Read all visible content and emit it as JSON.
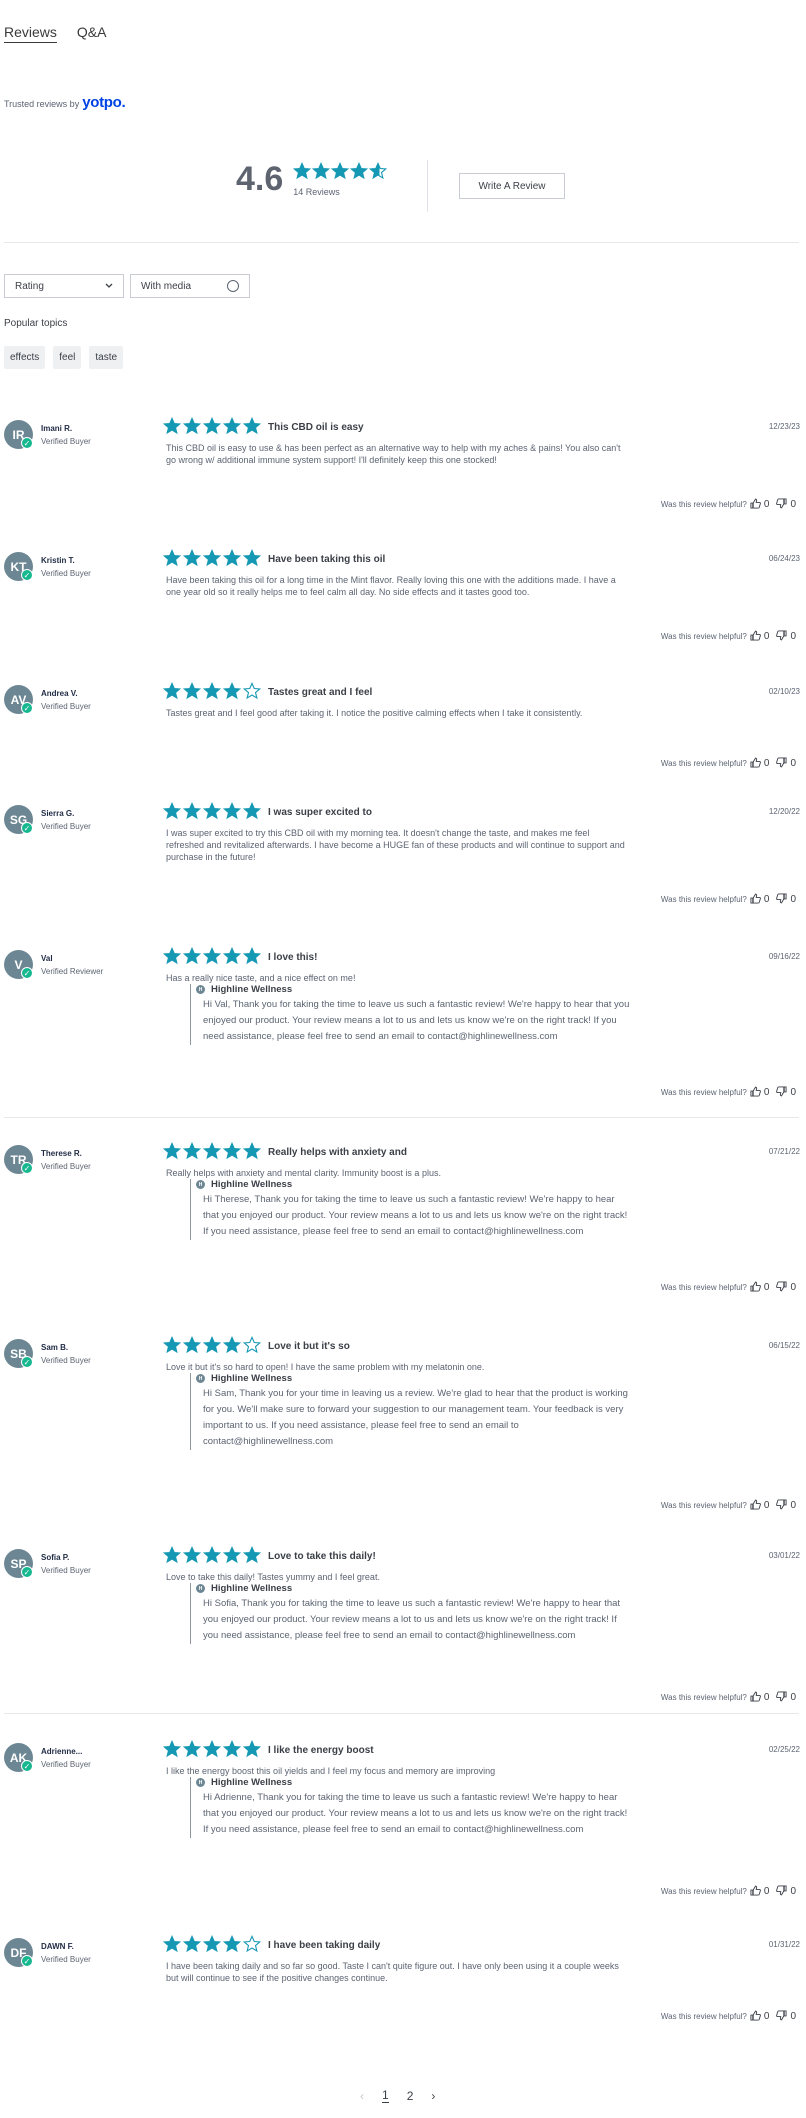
{
  "tabs": [
    {
      "label": "Reviews",
      "active": true
    },
    {
      "label": "Q&A",
      "active": false
    }
  ],
  "trusted": {
    "text": "Trusted reviews by",
    "brand": "yotpo."
  },
  "summary": {
    "average": "4.6",
    "count_label": "14 Reviews",
    "rating": 4.6,
    "write_label": "Write A Review"
  },
  "filters": {
    "rating_label": "Rating",
    "media_label": "With media"
  },
  "topics": {
    "label": "Popular topics",
    "items": [
      "effects",
      "feel",
      "taste"
    ]
  },
  "helpful_label": "Was this review helpful?",
  "colors": {
    "star": "#1598b3",
    "avatar": "#6c8793",
    "verified": "#17b890",
    "brand": "#0042e4"
  },
  "reviews": [
    {
      "initials": "IR",
      "name": "Imani R.",
      "badge": "Verified Buyer",
      "rating": 5,
      "title": "This CBD oil is easy",
      "date": "12/23/23",
      "body": "This CBD oil is easy to use & has been perfect as an alternative way to help with my aches & pains! You also can't go wrong w/ additional immune system support! I'll definitely keep this one stocked!",
      "up": "0",
      "down": "0"
    },
    {
      "initials": "KT",
      "name": "Kristin T.",
      "badge": "Verified Buyer",
      "rating": 5,
      "title": "Have been taking this oil",
      "date": "06/24/23",
      "body": "Have been taking this oil for a long time in the Mint flavor. Really loving this one with the additions made. I have a one year old so it really helps me to feel calm all day. No side effects and it tastes good too.",
      "up": "0",
      "down": "0"
    },
    {
      "initials": "AV",
      "name": "Andrea V.",
      "badge": "Verified Buyer",
      "rating": 4,
      "title": "Tastes great and I feel",
      "date": "02/10/23",
      "body": "Tastes great and I feel good after taking it. I notice the positive calming effects when I take it consistently.",
      "up": "0",
      "down": "0"
    },
    {
      "initials": "SG",
      "name": "Sierra G.",
      "badge": "Verified Buyer",
      "rating": 5,
      "title": "I was super excited to",
      "date": "12/20/22",
      "body": "I was super excited to try this CBD oil with my morning tea. It doesn't change the taste, and makes me feel refreshed and revitalized afterwards. I have become a HUGE fan of these products and will continue to support and purchase in the future!",
      "up": "0",
      "down": "0"
    },
    {
      "initials": "V",
      "name": "Val",
      "badge": "Verified Reviewer",
      "rating": 5,
      "title": "I love this!",
      "date": "09/16/22",
      "body": "Has a really nice taste, and a nice effect on me!",
      "reply_from": "Highline Wellness",
      "reply": "Hi Val, Thank you for taking the time to leave us such a fantastic review! We're happy to hear that you enjoyed our product. Your review means a lot to us and lets us know we're on the right track! If you need assistance, please feel free to send an email to contact@highlinewellness.com",
      "up": "0",
      "down": "0"
    },
    {
      "initials": "TR",
      "name": "Therese R.",
      "badge": "Verified Buyer",
      "rating": 5,
      "title": "Really helps with anxiety and",
      "date": "07/21/22",
      "body": "Really helps with anxiety and mental clarity. Immunity boost is a plus.",
      "reply_from": "Highline Wellness",
      "reply": "Hi Therese, Thank you for taking the time to leave us such a fantastic review! We're happy to hear that you enjoyed our product. Your review means a lot to us and lets us know we're on the right track! If you need assistance, please feel free to send an email to contact@highlinewellness.com",
      "up": "0",
      "down": "0"
    },
    {
      "initials": "SB",
      "name": "Sam B.",
      "badge": "Verified Buyer",
      "rating": 4,
      "title": "Love it but it's so",
      "date": "06/15/22",
      "body": "Love it but it's so hard to open! I have the same problem with my melatonin one.",
      "reply_from": "Highline Wellness",
      "reply": "Hi Sam, Thank you for your time in leaving us a review. We're glad to hear that the product is working for you. We'll make sure to forward your suggestion to our management team. Your feedback is very important to us. If you need assistance, please feel free to send an email to contact@highlinewellness.com",
      "up": "0",
      "down": "0"
    },
    {
      "initials": "SP",
      "name": "Sofia P.",
      "badge": "Verified Buyer",
      "rating": 5,
      "title": "Love to take this daily!",
      "date": "03/01/22",
      "body": "Love to take this daily! Tastes yummy and I feel great.",
      "reply_from": "Highline Wellness",
      "reply": "Hi Sofia, Thank you for taking the time to leave us such a fantastic review! We're happy to hear that you enjoyed our product. Your review means a lot to us and lets us know we're on the right track! If you need assistance, please feel free to send an email to contact@highlinewellness.com",
      "up": "0",
      "down": "0"
    },
    {
      "initials": "AK",
      "name": "Adrienne...",
      "badge": "Verified Buyer",
      "rating": 5,
      "title": "I like the energy boost",
      "date": "02/25/22",
      "body": "I like the energy boost this oil yields and I feel my focus and memory are improving",
      "reply_from": "Highline Wellness",
      "reply": "Hi Adrienne, Thank you for taking the time to leave us such a fantastic review! We're happy to hear that you enjoyed our product. Your review means a lot to us and lets us know we're on the right track! If you need assistance, please feel free to send an email to contact@highlinewellness.com",
      "up": "0",
      "down": "0"
    },
    {
      "initials": "DF",
      "name": "DAWN F.",
      "badge": "Verified Buyer",
      "rating": 4,
      "title": "I have been taking daily",
      "date": "01/31/22",
      "body": "I have been taking daily and so far so good. Taste I can't quite figure out. I have only been using it a couple weeks but will continue to see if the positive changes continue.",
      "up": "0",
      "down": "0"
    }
  ],
  "pagination": {
    "pages": [
      "1",
      "2"
    ],
    "current": "1"
  }
}
